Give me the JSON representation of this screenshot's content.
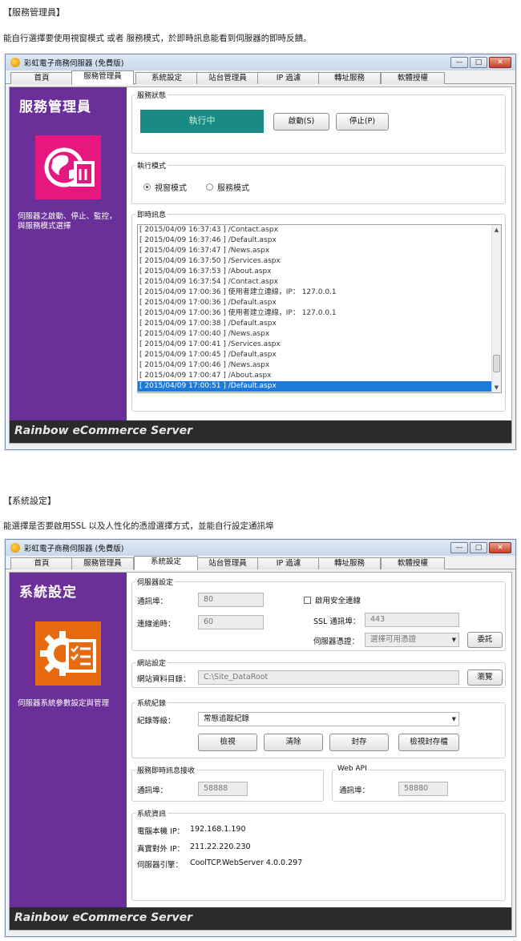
{
  "section1": {
    "heading": "【服務管理員】",
    "description": "能自行選擇要使用視窗模式 或者 服務模式，於即時訊息能看到伺服器的即時反饋。"
  },
  "section2": {
    "heading": "【系統設定】",
    "description": "能選擇是否要啟用SSL 以及人性化的憑證選擇方式，並能自行設定通訊埠"
  },
  "window": {
    "title": "彩虹電子商務伺服器 (免費版)",
    "minimize": "—",
    "maximize": "□",
    "close": "✕",
    "footer": "Rainbow eCommerce Server"
  },
  "tabs": [
    "首頁",
    "服務管理員",
    "系統設定",
    "站台管理員",
    "IP 過濾",
    "轉址服務",
    "軟體授權"
  ],
  "service_manager": {
    "side_title": "服務管理員",
    "side_desc": "伺服器之啟動、停止、監控，與服務模式選擇",
    "status_group": "服務狀態",
    "status_text": "執行中",
    "start_button": "啟動(S)",
    "stop_button": "停止(P)",
    "mode_group": "執行模式",
    "mode_window": "視窗模式",
    "mode_service": "服務模式",
    "log_group": "即時訊息",
    "log": [
      "[ 2015/04/09 16:37:43 ] /Contact.aspx",
      "[ 2015/04/09 16:37:46 ] /Default.aspx",
      "[ 2015/04/09 16:37:47 ] /News.aspx",
      "[ 2015/04/09 16:37:50 ] /Services.aspx",
      "[ 2015/04/09 16:37:53 ] /About.aspx",
      "[ 2015/04/09 16:37:54 ] /Contact.aspx",
      "[ 2015/04/09 17:00:36 ] 使用者建立連線，IP： 127.0.0.1",
      "[ 2015/04/09 17:00:36 ] /Default.aspx",
      "[ 2015/04/09 17:00:36 ] 使用者建立連線，IP： 127.0.0.1",
      "[ 2015/04/09 17:00:38 ] /Default.aspx",
      "[ 2015/04/09 17:00:40 ] /News.aspx",
      "[ 2015/04/09 17:00:41 ] /Services.aspx",
      "[ 2015/04/09 17:00:45 ] /Default.aspx",
      "[ 2015/04/09 17:00:46 ] /News.aspx",
      "[ 2015/04/09 17:00:47 ] /About.aspx",
      "[ 2015/04/09 17:00:51 ] /Default.aspx"
    ]
  },
  "system_settings": {
    "side_title": "系統設定",
    "side_desc": "伺服器系統參數設定與管理",
    "server_group": "伺服器設定",
    "port_label": "通訊埠：",
    "port_value": "80",
    "timeout_label": "連線逾時：",
    "timeout_value": "60",
    "ssl_checkbox": "啟用安全連線",
    "ssl_port_label": "SSL 通訊埠：",
    "ssl_port_value": "443",
    "cert_label": "伺服器憑證：",
    "cert_placeholder": "選擇可用憑證",
    "register_button": "委託",
    "site_group": "網站設定",
    "site_dir_label": "網站資料目錄：",
    "site_dir_value": "C:\\Site_DataRoot",
    "browse_button": "瀏覽",
    "log_group": "系統紀錄",
    "log_level_label": "紀錄等級：",
    "log_level_value": "常態追蹤紀錄",
    "view_button": "檢視",
    "clear_button": "清除",
    "archive_button": "封存",
    "view_archive_button": "檢視封存檔",
    "realtime_group": "服務即時訊息接收",
    "realtime_port_label": "通訊埠：",
    "realtime_port_value": "58888",
    "webapi_group": "Web API",
    "webapi_port_label": "通訊埠：",
    "webapi_port_value": "58880",
    "info_group": "系統資訊",
    "local_ip_label": "電腦本機 IP：",
    "local_ip_value": "192.168.1.190",
    "public_ip_label": "真實對外 IP：",
    "public_ip_value": "211.22.220.230",
    "engine_label": "伺服器引擎：",
    "engine_value": "CoolTCP.WebServer 4.0.0.297"
  },
  "colors": {
    "sidebar": "#6b2f9a",
    "status_box": "#1a8a84",
    "service_icon": "#e6177f",
    "settings_icon": "#e86a10",
    "selection": "#1e7ad8"
  },
  "icons": {
    "service": "globe-document-icon",
    "settings": "gear-checklist-icon"
  }
}
